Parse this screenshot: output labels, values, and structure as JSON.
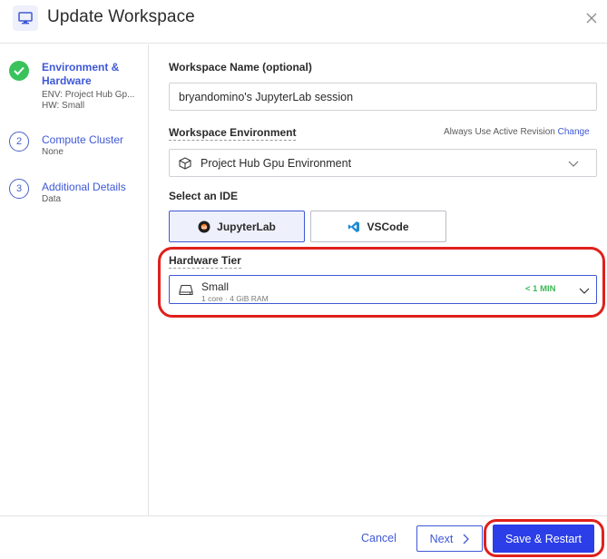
{
  "header": {
    "title": "Update Workspace",
    "icon": "monitor-icon",
    "close_icon": "close-icon"
  },
  "stepper": {
    "steps": [
      {
        "number": "",
        "title": "Environment & Hardware",
        "title_line1": "Environment &",
        "title_line2": "Hardware",
        "sub1": "ENV: Project Hub Gp...",
        "sub2": "HW: Small",
        "state": "complete"
      },
      {
        "number": "2",
        "title": "Compute Cluster",
        "sub1": "None",
        "state": "pending"
      },
      {
        "number": "3",
        "title": "Additional Details",
        "sub1": "Data",
        "state": "pending"
      }
    ]
  },
  "form": {
    "workspace_name_label": "Workspace Name (optional)",
    "workspace_name_value": "bryandomino's JupyterLab session",
    "environment_label": "Workspace Environment",
    "environment_hint": "Always Use Active Revision",
    "environment_change_link": "Change",
    "environment_value": "Project Hub Gpu Environment",
    "ide_label": "Select an IDE",
    "ide_options": [
      {
        "label": "JupyterLab",
        "icon": "jupyterlab-icon",
        "selected": true
      },
      {
        "label": "VSCode",
        "icon": "vscode-icon",
        "selected": false
      }
    ],
    "hardware_label": "Hardware Tier",
    "hardware_value": "Small",
    "hardware_spec": "1 core · 4 GiB RAM",
    "hardware_time": "< 1 MIN"
  },
  "footer": {
    "cancel_label": "Cancel",
    "next_label": "Next",
    "save_label": "Save & Restart"
  },
  "colors": {
    "accent": "#3f58d6",
    "primary_button": "#2b3ee8",
    "success": "#3ac25c",
    "annotation": "#e0201c"
  }
}
